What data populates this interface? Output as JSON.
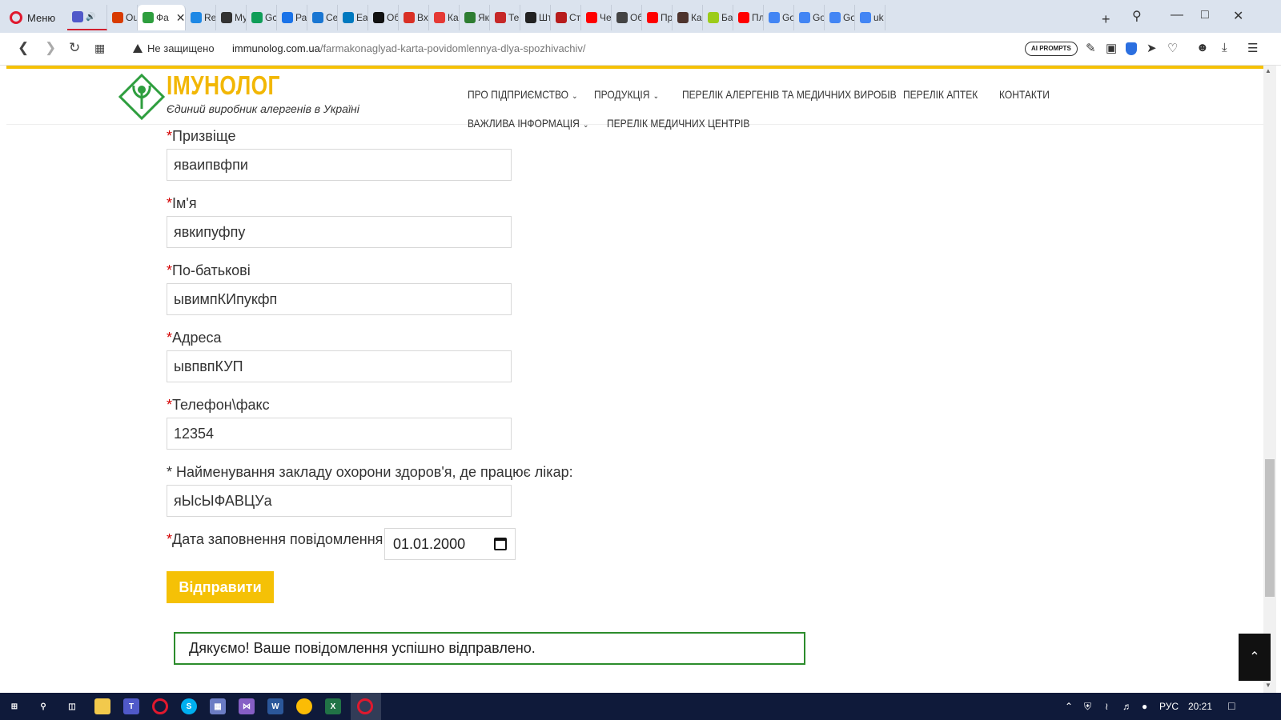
{
  "browser": {
    "menu_label": "Меню",
    "tabs": [
      {
        "label": "",
        "icon": "teams-icon",
        "color": "#5059c9"
      },
      {
        "label": "Ou",
        "icon": "headset-icon",
        "color": "#d83b01"
      },
      {
        "label": "Фа",
        "icon": "immunolog-favicon",
        "color": "#2e9e3e"
      },
      {
        "label": "Re",
        "icon": "u-icon",
        "color": "#1e88e5"
      },
      {
        "label": "Му",
        "icon": "cap-icon",
        "color": "#333333"
      },
      {
        "label": "Gc",
        "icon": "sheets-icon",
        "color": "#0f9d58"
      },
      {
        "label": "Ра",
        "icon": "grid-icon",
        "color": "#1a73e8"
      },
      {
        "label": "Се",
        "icon": "c-icon",
        "color": "#1976d2"
      },
      {
        "label": "Еа",
        "icon": "trello-icon",
        "color": "#0079bf"
      },
      {
        "label": "Об",
        "icon": "github-icon",
        "color": "#111111"
      },
      {
        "label": "Вх",
        "icon": "gmail-icon",
        "color": "#d93025"
      },
      {
        "label": "Ка",
        "icon": "x-icon",
        "color": "#e53935"
      },
      {
        "label": "Як",
        "icon": "globe-icon",
        "color": "#2e7d32"
      },
      {
        "label": "Те",
        "icon": "p-icon",
        "color": "#c62828"
      },
      {
        "label": "Шт",
        "icon": "ua-icon",
        "color": "#222222"
      },
      {
        "label": "Ст",
        "icon": "q-icon",
        "color": "#b71c1c"
      },
      {
        "label": "Че",
        "icon": "youtube-icon",
        "color": "#ff0000"
      },
      {
        "label": "Об",
        "icon": "vz-icon",
        "color": "#444444"
      },
      {
        "label": "Пр",
        "icon": "youtube-icon",
        "color": "#ff0000"
      },
      {
        "label": "Ка",
        "icon": "dark-icon",
        "color": "#4e342e"
      },
      {
        "label": "Ба",
        "icon": "f-icon",
        "color": "#9ccc1a"
      },
      {
        "label": "Пл",
        "icon": "youtube-icon",
        "color": "#ff0000"
      },
      {
        "label": "Go",
        "icon": "translate-icon",
        "color": "#4285f4"
      },
      {
        "label": "Go",
        "icon": "translate-icon",
        "color": "#4285f4"
      },
      {
        "label": "Go",
        "icon": "translate-icon",
        "color": "#4285f4"
      },
      {
        "label": "uk",
        "icon": "google-icon",
        "color": "#4285f4"
      }
    ],
    "security_text": "Не защищено",
    "url_host": "immunolog.com.ua",
    "url_path": "/farmakonaglyad-karta-povidomlennya-dlya-spozhivachiv/",
    "ai_prompts_label": "AI PROMPTS"
  },
  "site": {
    "logo_name": "ІМУНОЛОГ",
    "logo_tagline": "Єдиний виробник алергенів в Україні",
    "nav": {
      "about": "ПРО ПІДПРИЄМСТВО",
      "products": "ПРОДУКЦІЯ",
      "allergens": "ПЕРЕЛІК АЛЕРГЕНІВ ТА МЕДИЧНИХ ВИРОБІВ",
      "pharmacies": "ПЕРЕЛІК АПТЕК",
      "contacts": "КОНТАКТИ",
      "important": "ВАЖЛИВА ІНФОРМАЦІЯ",
      "centers": "ПЕРЕЛІК МЕДИЧНИХ ЦЕНТРІВ"
    },
    "accent_color": "#f5c106"
  },
  "form": {
    "surname": {
      "label": "Призвіще",
      "value": "яваипвфпи"
    },
    "name": {
      "label": "Ім'я",
      "value": "явкипуфпу"
    },
    "patronymic": {
      "label": "По-батькові",
      "value": "ывимпКИпукфп"
    },
    "address": {
      "label": "Адреса",
      "value": "ывпвпКУП"
    },
    "phone": {
      "label": "Телефон\\факс",
      "value": "12354"
    },
    "facility": {
      "label": "* Найменування закладу охорони здоров'я, де працює лікар:",
      "value": "яЫсЫФАВЦУа"
    },
    "date": {
      "label": "Дата заповнення повідомлення:",
      "value": "01.01.2000"
    },
    "required_mark": "*",
    "submit_label": "Відправити",
    "success_message": "Дякуємо! Ваше повідомлення успішно відправлено."
  },
  "taskbar": {
    "language": "РУС",
    "time": "20:21"
  }
}
